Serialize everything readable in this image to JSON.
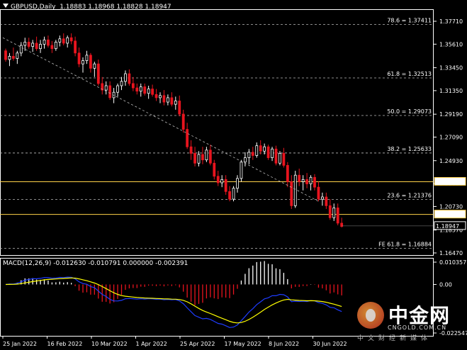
{
  "header": {
    "title": "GBPUSD,Daily",
    "ohlc": "1.18883 1.18968 1.18828 1.18947"
  },
  "macd": {
    "label": "MACD(12,26,9) -0.012630 -0.010791 0.000000 -0.002391",
    "axis": [
      "0.010357",
      "0.00",
      "-0.022547"
    ]
  },
  "price_axis": {
    "labels": [
      "1.37710",
      "1.35610",
      "1.33450",
      "1.31350",
      "1.29190",
      "1.27090",
      "1.24930",
      "1.22830",
      "1.20730",
      "1.18570",
      "1.16470"
    ],
    "current_price": "1.18947",
    "hline_labels": [
      "1.23000",
      "1.20000"
    ]
  },
  "fib_levels": [
    "78.6 = 1.37411",
    "61.8 = 1.32513",
    "50.0 = 1.29073",
    "38.2 = 1.25633",
    "23.6 = 1.21376",
    "FE 61.8 = 1.16884"
  ],
  "dates": [
    "25 Jan 2022",
    "16 Feb 2022",
    "10 Mar 2022",
    "1 Apr 2022",
    "25 Apr 2022",
    "17 May 2022",
    "8 Jun 2022",
    "30 Jun 2022"
  ],
  "colors": {
    "bull": "#ffffff",
    "bear": "#e8141e",
    "hline": "#ffd24a",
    "macd_hist_up": "#ffffff",
    "macd_hist_down": "#e8141e",
    "macd_line": "#1e3cff",
    "signal_line": "#ffff00"
  },
  "watermark": {
    "brand_cn": "中金网",
    "url": "CNGOLD.COM.CN",
    "slogan": "中文财经新媒体"
  },
  "chart_data": {
    "type": "candlestick",
    "series": [
      {
        "name": "GBPUSD,Daily",
        "ohlc": [
          [
            1.35,
            1.352,
            1.34,
            1.342
          ],
          [
            1.342,
            1.348,
            1.336,
            1.345
          ],
          [
            1.345,
            1.353,
            1.341,
            1.343
          ],
          [
            1.343,
            1.35,
            1.338,
            1.348
          ],
          [
            1.348,
            1.358,
            1.345,
            1.355
          ],
          [
            1.355,
            1.362,
            1.35,
            1.358
          ],
          [
            1.358,
            1.362,
            1.352,
            1.354
          ],
          [
            1.354,
            1.36,
            1.349,
            1.357
          ],
          [
            1.357,
            1.363,
            1.35,
            1.352
          ],
          [
            1.352,
            1.36,
            1.348,
            1.356
          ],
          [
            1.356,
            1.363,
            1.352,
            1.36
          ],
          [
            1.36,
            1.364,
            1.353,
            1.355
          ],
          [
            1.355,
            1.359,
            1.348,
            1.352
          ],
          [
            1.352,
            1.36,
            1.35,
            1.358
          ],
          [
            1.358,
            1.364,
            1.354,
            1.361
          ],
          [
            1.361,
            1.366,
            1.355,
            1.357
          ],
          [
            1.357,
            1.364,
            1.353,
            1.362
          ],
          [
            1.362,
            1.366,
            1.356,
            1.359
          ],
          [
            1.359,
            1.363,
            1.345,
            1.348
          ],
          [
            1.348,
            1.353,
            1.335,
            1.338
          ],
          [
            1.338,
            1.344,
            1.33,
            1.341
          ],
          [
            1.341,
            1.35,
            1.338,
            1.346
          ],
          [
            1.346,
            1.348,
            1.33,
            1.334
          ],
          [
            1.334,
            1.34,
            1.326,
            1.338
          ],
          [
            1.338,
            1.342,
            1.318,
            1.32
          ],
          [
            1.32,
            1.326,
            1.31,
            1.314
          ],
          [
            1.314,
            1.322,
            1.31,
            1.318
          ],
          [
            1.318,
            1.322,
            1.305,
            1.307
          ],
          [
            1.307,
            1.316,
            1.302,
            1.312
          ],
          [
            1.312,
            1.32,
            1.308,
            1.318
          ],
          [
            1.318,
            1.326,
            1.314,
            1.322
          ],
          [
            1.322,
            1.332,
            1.318,
            1.329
          ],
          [
            1.329,
            1.333,
            1.318,
            1.32
          ],
          [
            1.32,
            1.326,
            1.313,
            1.316
          ],
          [
            1.316,
            1.32,
            1.31,
            1.313
          ],
          [
            1.313,
            1.32,
            1.308,
            1.317
          ],
          [
            1.317,
            1.32,
            1.309,
            1.311
          ],
          [
            1.311,
            1.318,
            1.306,
            1.315
          ],
          [
            1.315,
            1.319,
            1.308,
            1.31
          ],
          [
            1.31,
            1.315,
            1.304,
            1.307
          ],
          [
            1.307,
            1.312,
            1.302,
            1.309
          ],
          [
            1.309,
            1.314,
            1.3,
            1.303
          ],
          [
            1.303,
            1.31,
            1.3,
            1.307
          ],
          [
            1.307,
            1.312,
            1.299,
            1.301
          ],
          [
            1.301,
            1.308,
            1.296,
            1.304
          ],
          [
            1.304,
            1.309,
            1.29,
            1.292
          ],
          [
            1.292,
            1.296,
            1.275,
            1.278
          ],
          [
            1.278,
            1.284,
            1.26,
            1.262
          ],
          [
            1.262,
            1.268,
            1.25,
            1.256
          ],
          [
            1.256,
            1.262,
            1.244,
            1.247
          ],
          [
            1.247,
            1.258,
            1.244,
            1.255
          ],
          [
            1.255,
            1.262,
            1.246,
            1.25
          ],
          [
            1.25,
            1.262,
            1.248,
            1.259
          ],
          [
            1.259,
            1.264,
            1.245,
            1.247
          ],
          [
            1.247,
            1.25,
            1.232,
            1.235
          ],
          [
            1.235,
            1.24,
            1.226,
            1.229
          ],
          [
            1.229,
            1.236,
            1.225,
            1.232
          ],
          [
            1.232,
            1.236,
            1.218,
            1.221
          ],
          [
            1.221,
            1.226,
            1.212,
            1.214
          ],
          [
            1.214,
            1.226,
            1.212,
            1.224
          ],
          [
            1.224,
            1.236,
            1.22,
            1.233
          ],
          [
            1.233,
            1.25,
            1.23,
            1.248
          ],
          [
            1.248,
            1.257,
            1.244,
            1.252
          ],
          [
            1.252,
            1.26,
            1.246,
            1.257
          ],
          [
            1.257,
            1.262,
            1.25,
            1.254
          ],
          [
            1.254,
            1.266,
            1.252,
            1.263
          ],
          [
            1.263,
            1.268,
            1.255,
            1.258
          ],
          [
            1.258,
            1.265,
            1.255,
            1.262
          ],
          [
            1.262,
            1.264,
            1.25,
            1.252
          ],
          [
            1.252,
            1.262,
            1.249,
            1.26
          ],
          [
            1.26,
            1.263,
            1.245,
            1.247
          ],
          [
            1.247,
            1.258,
            1.245,
            1.256
          ],
          [
            1.256,
            1.261,
            1.243,
            1.245
          ],
          [
            1.245,
            1.248,
            1.225,
            1.23
          ],
          [
            1.23,
            1.236,
            1.205,
            1.208
          ],
          [
            1.208,
            1.24,
            1.206,
            1.236
          ],
          [
            1.236,
            1.242,
            1.226,
            1.23
          ],
          [
            1.23,
            1.236,
            1.222,
            1.232
          ],
          [
            1.232,
            1.238,
            1.224,
            1.228
          ],
          [
            1.228,
            1.236,
            1.222,
            1.234
          ],
          [
            1.234,
            1.237,
            1.222,
            1.225
          ],
          [
            1.225,
            1.23,
            1.212,
            1.214
          ],
          [
            1.214,
            1.22,
            1.208,
            1.216
          ],
          [
            1.216,
            1.22,
            1.205,
            1.208
          ],
          [
            1.208,
            1.214,
            1.195,
            1.197
          ],
          [
            1.197,
            1.21,
            1.194,
            1.206
          ],
          [
            1.206,
            1.21,
            1.19,
            1.192
          ],
          [
            1.192,
            1.197,
            1.188,
            1.189
          ]
        ]
      }
    ],
    "ylim": [
      1.1647,
      1.3771
    ],
    "macd_ylim": [
      -0.022547,
      0.010357
    ]
  }
}
